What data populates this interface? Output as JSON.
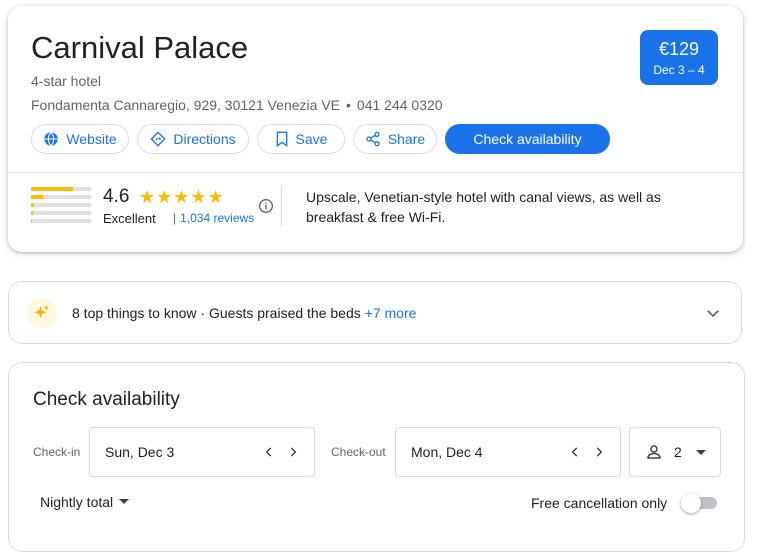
{
  "hotel": {
    "name": "Carnival Palace",
    "class": "4-star hotel",
    "address": "Fondamenta Cannaregio, 929, 30121 Venezia VE",
    "separator": "•",
    "phone": "041 244 0320"
  },
  "price": {
    "amount": "€129",
    "dates": "Dec 3 – 4"
  },
  "actions": {
    "website": "Website",
    "directions": "Directions",
    "save": "Save",
    "share": "Share",
    "check_availability": "Check availability"
  },
  "rating": {
    "score": "4.6",
    "stars": "★★★★★",
    "label": "Excellent",
    "separator": "|",
    "reviews": "1,034 reviews",
    "distribution_fraction": [
      0.7,
      0.2,
      0.05,
      0.03,
      0.02
    ]
  },
  "description": "Upscale, Venetian-style hotel with canal views, as well as breakfast & free Wi-Fi.",
  "tips": {
    "bold": "8 top things to know",
    "dot": " · ",
    "text": "Guests praised the beds",
    "more": "+7 more"
  },
  "availability": {
    "title": "Check availability",
    "checkin_label": "Check-in",
    "checkin_value": "Sun, Dec 3",
    "checkout_label": "Check-out",
    "checkout_value": "Mon, Dec 4",
    "guests": "2",
    "nightly_total": "Nightly total",
    "free_cancellation": "Free cancellation only",
    "free_cancellation_on": false
  },
  "colors": {
    "accent": "#1a73e8",
    "star": "#fbbc04",
    "text": "#202124",
    "muted": "#5f6368"
  },
  "icons": [
    "globe-icon",
    "directions-icon",
    "bookmark-icon",
    "share-icon",
    "info-icon",
    "sparkle-icon",
    "chevron-down-icon",
    "chevron-left-icon",
    "chevron-right-icon",
    "person-icon",
    "dropdown-arrow-icon"
  ]
}
